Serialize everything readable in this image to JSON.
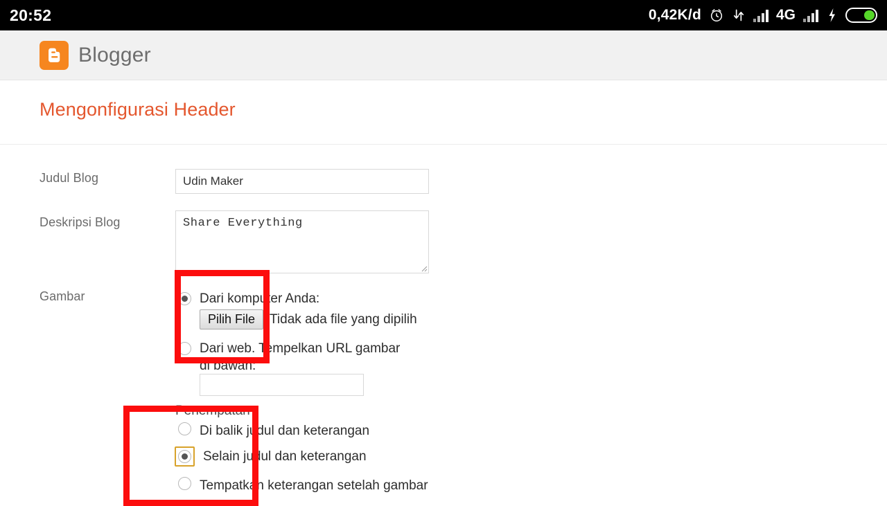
{
  "statusbar": {
    "clock": "20:52",
    "data_rate": "0,42K/d",
    "network_type": "4G",
    "icons": [
      "alarm-clock-icon",
      "data-transfer-icon",
      "signal-bars-icon",
      "signal-bars-icon",
      "charging-bolt-icon",
      "battery-icon"
    ]
  },
  "appbar": {
    "logo_letter": "B",
    "brand": "Blogger"
  },
  "page": {
    "title": "Mengonfigurasi Header"
  },
  "form": {
    "blog_title": {
      "label": "Judul Blog",
      "value": "Udin Maker",
      "placeholder": ""
    },
    "blog_description": {
      "label": "Deskripsi Blog",
      "value": "Share Everything",
      "placeholder": ""
    },
    "image": {
      "label": "Gambar",
      "from_computer": {
        "label": "Dari komputer Anda:",
        "selected": true,
        "button_label": "Pilih File",
        "file_status": "Tidak ada file yang dipilih"
      },
      "from_web": {
        "label": "Dari web. Tempelkan URL gambar di bawah:",
        "selected": false,
        "url_value": "",
        "url_placeholder": ""
      }
    },
    "placement": {
      "label": "Penempatan",
      "options": [
        {
          "label": "Di balik judul dan keterangan",
          "selected": false,
          "focused": false
        },
        {
          "label": "Selain judul dan keterangan",
          "selected": true,
          "focused": true
        },
        {
          "label": "Tempatkan keterangan setelah gambar",
          "selected": false,
          "focused": false
        }
      ]
    }
  },
  "annotations": {
    "highlight_color": "#fc0d0d",
    "boxes": [
      {
        "name": "image-source-highlight"
      },
      {
        "name": "placement-highlight"
      }
    ]
  },
  "colors": {
    "brand_orange": "#f6861f",
    "title_orange": "#e4572e",
    "focus_gold": "#d8a22a",
    "battery_green": "#56d72a"
  }
}
